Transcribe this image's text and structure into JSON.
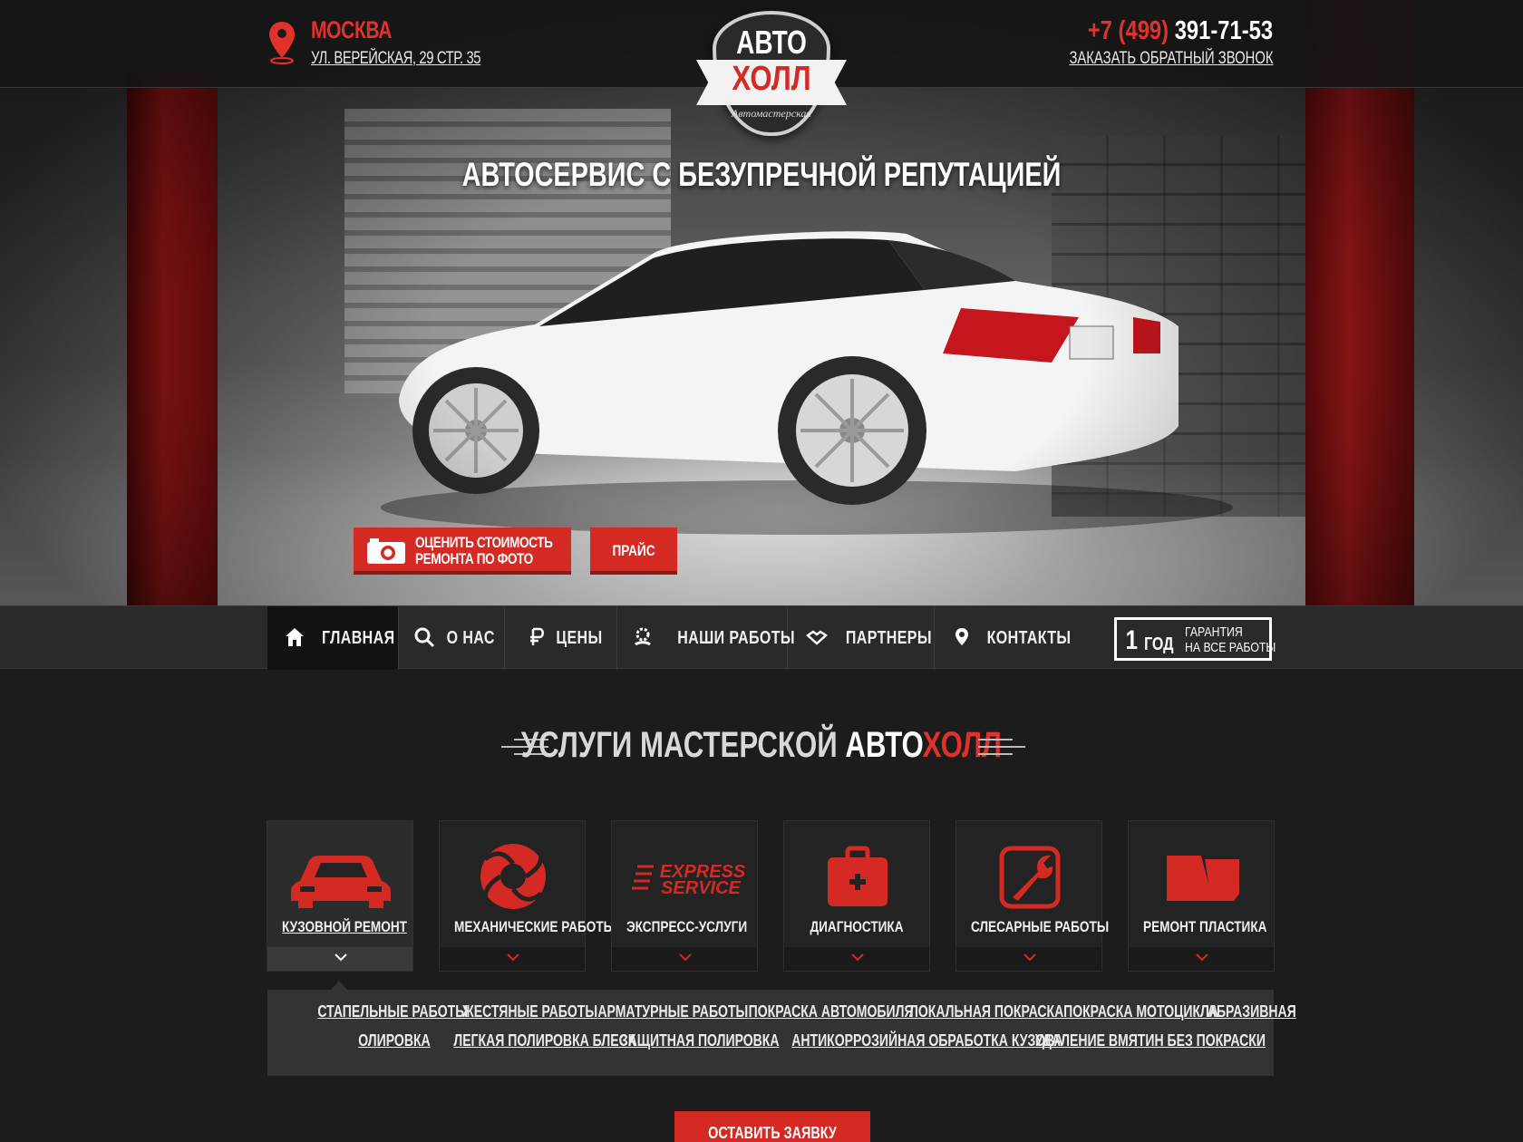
{
  "header": {
    "city": "МОСКВА",
    "address": "УЛ. ВЕРЕЙСКАЯ, 29 СТР. 35",
    "phone_code": "+7 (499)",
    "phone_number": "391-71-53",
    "callback": "ЗАКАЗАТЬ ОБРАТНЫЙ ЗВОНОК"
  },
  "logo": {
    "top": "АВТО",
    "bottom": "ХОЛЛ",
    "sub": "Автомастерская"
  },
  "hero": {
    "tagline": "АВТОСЕРВИС С БЕЗУПРЕЧНОЙ РЕПУТАЦИЕЙ",
    "photo_btn_line1": "ОЦЕНИТЬ СТОИМОСТЬ",
    "photo_btn_line2": "РЕМОНТА ПО ФОТО",
    "price_btn": "ПРАЙС"
  },
  "nav": {
    "items": [
      {
        "label": "ГЛАВНАЯ",
        "icon": "home-icon"
      },
      {
        "label": "О НАС",
        "icon": "search-icon"
      },
      {
        "label": "ЦЕНЫ",
        "icon": "ruble-icon"
      },
      {
        "label": "НАШИ РАБОТЫ",
        "icon": "gear-hand-icon"
      },
      {
        "label": "ПАРТНЕРЫ",
        "icon": "handshake-icon"
      },
      {
        "label": "КОНТАКТЫ",
        "icon": "location-icon"
      }
    ],
    "warranty_num": "1",
    "warranty_unit": "ГОД",
    "warranty_line1": "ГАРАНТИЯ",
    "warranty_line2": "НА ВСЕ РАБОТЫ"
  },
  "services": {
    "title_main": "УСЛУГИ МАСТЕРСКОЙ ",
    "title_white": "АВТО",
    "title_red": "ХОЛЛ",
    "cards": [
      {
        "label": "КУЗОВНОЙ РЕМОНТ",
        "icon": "car-icon"
      },
      {
        "label": "МЕХАНИЧЕСКИЕ РАБОТЫ",
        "icon": "gear-icon"
      },
      {
        "label": "ЭКСПРЕСС-УСЛУГИ",
        "icon": "express-service-icon",
        "icon_text1": "EXPRESS",
        "icon_text2": "SERVICE"
      },
      {
        "label": "ДИАГНОСТИКА",
        "icon": "medkit-icon"
      },
      {
        "label": "СЛЕСАРНЫЕ РАБОТЫ",
        "icon": "wrench-icon"
      },
      {
        "label": "РЕМОНТ ПЛАСТИКА",
        "icon": "broken-plastic-icon"
      }
    ],
    "sublinks": [
      "СТАПЕЛЬНЫЕ РАБОТЫ",
      "ЖЕСТЯНЫЕ РАБОТЫ",
      "АРМАТУРНЫЕ РАБОТЫ",
      "ПОКРАСКА АВТОМОБИЛЯ",
      "ЛОКАЛЬНАЯ ПОКРАСКА",
      "ПОКРАСКА МОТОЦИКЛА",
      "АБРАЗИВНАЯ",
      "ОЛИРОВКА",
      "ЛЕГКАЯ ПОЛИРОВКА БЛЕСК",
      "ЗАЩИТНАЯ ПОЛИРОВКА",
      "АНТИКОРРОЗИЙНАЯ ОБРАБОТКА КУЗОВА",
      "УДАЛЕНИЕ ВМЯТИН БЕЗ ПОКРАСКИ"
    ],
    "request_btn": "ОСТАВИТЬ ЗАЯВКУ"
  },
  "colors": {
    "accent": "#d42a23",
    "bg": "#1c1c1c"
  }
}
